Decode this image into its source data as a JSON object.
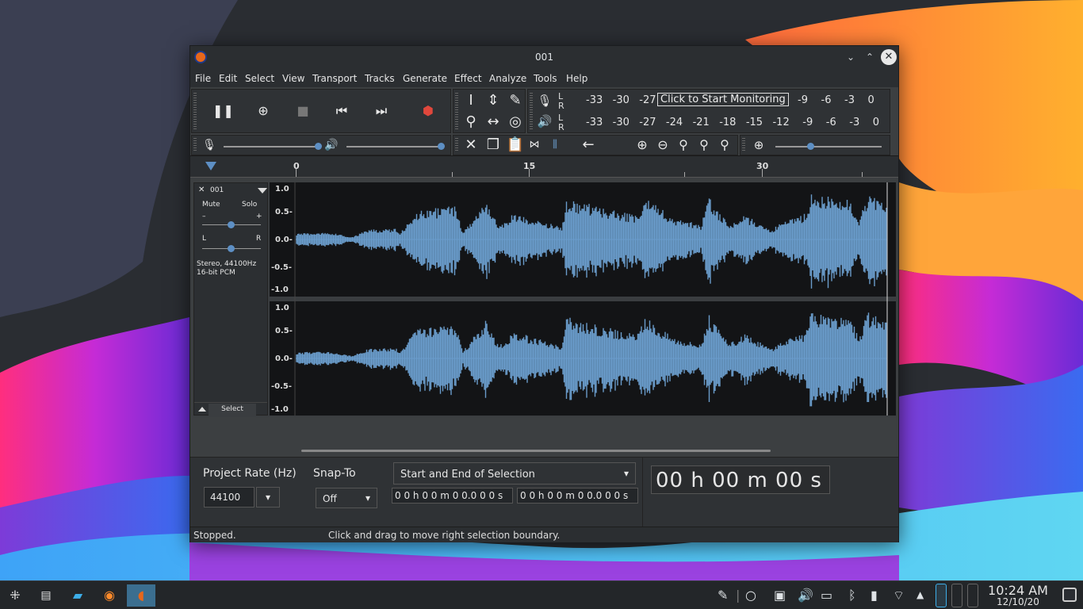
{
  "window": {
    "title": "001"
  },
  "menu": [
    "File",
    "Edit",
    "Select",
    "View",
    "Transport",
    "Tracks",
    "Generate",
    "Effect",
    "Analyze",
    "Tools",
    "Help"
  ],
  "meters": {
    "rec_left_scale": [
      "-33",
      "-30",
      "-27"
    ],
    "monitor_prompt": "Click to Start Monitoring",
    "rec_right_scale": [
      "-9",
      "-6",
      "-3",
      "0"
    ],
    "play_scale": [
      "-33",
      "-30",
      "-27",
      "-24",
      "-21",
      "-18",
      "-15",
      "-12",
      "-9",
      "-6",
      "-3",
      "0"
    ],
    "l": "L",
    "r": "R"
  },
  "ruler": {
    "ticks": [
      "0",
      "15",
      "30"
    ]
  },
  "track": {
    "name": "001",
    "mute": "Mute",
    "solo": "Solo",
    "gain_minus": "–",
    "gain_plus": "+",
    "pan_left": "L",
    "pan_right": "R",
    "info_line1": "Stereo, 44100Hz",
    "info_line2": "16-bit PCM",
    "select": "Select",
    "scale": [
      "1.0",
      "0.5-",
      "0.0-",
      "-0.5-",
      "-1.0"
    ]
  },
  "bottom": {
    "project_rate_label": "Project Rate (Hz)",
    "project_rate_value": "44100",
    "snap_label": "Snap-To",
    "snap_value": "Off",
    "selection_mode": "Start and End of Selection",
    "sel_start": "0 0 h 0 0 m 0 0.0 0 0 s",
    "sel_end": "0 0 h 0 0 m 0 0.0 0 0 s",
    "audio_position": "00 h 00 m 00 s"
  },
  "status": {
    "left": "Stopped.",
    "right": "Click and drag to move right selection boundary."
  },
  "taskbar": {
    "time": "10:24 AM",
    "date": "12/10/20"
  },
  "colors": {
    "waveform": "#6a9ccb",
    "accent": "#3daee9"
  }
}
